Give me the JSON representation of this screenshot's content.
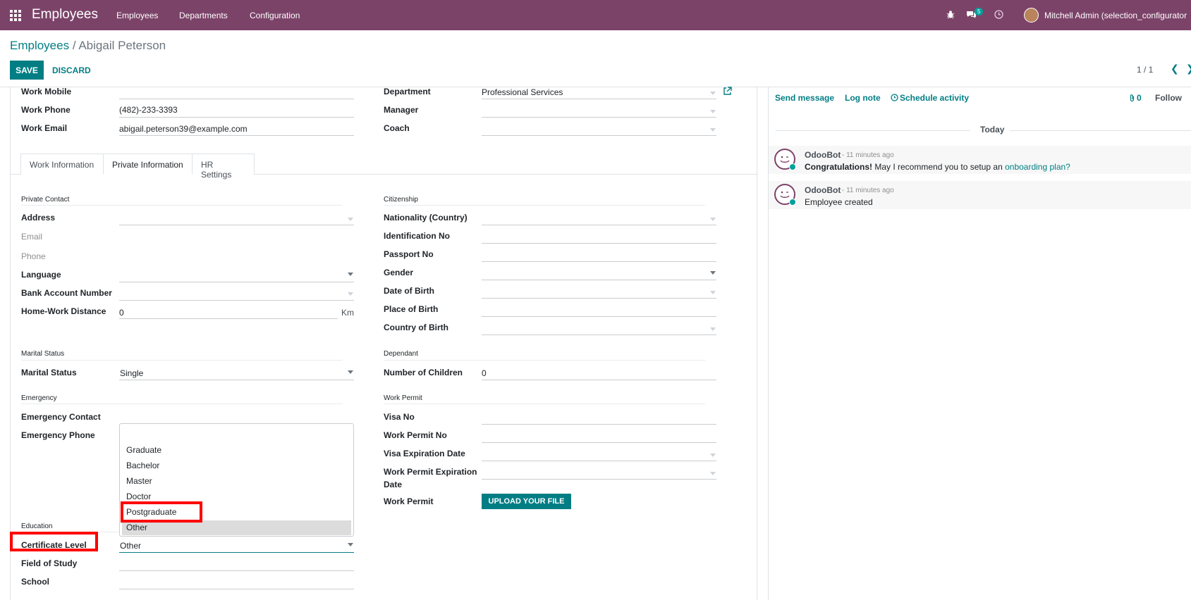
{
  "navbar": {
    "brand": "Employees",
    "menu": [
      "Employees",
      "Departments",
      "Configuration"
    ],
    "message_count": "5",
    "user": "Mitchell Admin (selection_configurator"
  },
  "breadcrumb": {
    "parent": "Employees",
    "separator": " / ",
    "current": "Abigail Peterson"
  },
  "buttons": {
    "save": "SAVE",
    "discard": "DISCARD",
    "upload": "UPLOAD YOUR FILE"
  },
  "pager": {
    "value": "1 / 1"
  },
  "header_fields": {
    "work_mobile": {
      "label": "Work Mobile",
      "value": ""
    },
    "work_phone": {
      "label": "Work Phone",
      "value": "(482)-233-3393"
    },
    "work_email": {
      "label": "Work Email",
      "value": "abigail.peterson39@example.com"
    },
    "department": {
      "label": "Department",
      "value": "Professional Services"
    },
    "manager": {
      "label": "Manager",
      "value": ""
    },
    "coach": {
      "label": "Coach",
      "value": ""
    }
  },
  "tabs": [
    "Work Information",
    "Private Information",
    "HR Settings"
  ],
  "private": {
    "private_contact": "Private Contact",
    "address": "Address",
    "email": "Email",
    "phone": "Phone",
    "language": "Language",
    "bank_account": "Bank Account Number",
    "home_work_distance": "Home-Work Distance",
    "distance_value": "0",
    "distance_unit": "Km",
    "marital_status_section": "Marital Status",
    "marital_status": "Marital Status",
    "marital_value": "Single",
    "emergency_section": "Emergency",
    "emergency_contact": "Emergency Contact",
    "emergency_phone": "Emergency Phone",
    "education_section": "Education",
    "certificate_level": "Certificate Level",
    "certificate_value": "Other",
    "field_of_study": "Field of Study",
    "school": "School"
  },
  "citizenship": {
    "section": "Citizenship",
    "nationality": "Nationality (Country)",
    "identification": "Identification No",
    "passport": "Passport No",
    "gender": "Gender",
    "dob": "Date of Birth",
    "pob": "Place of Birth",
    "cob": "Country of Birth",
    "dependant_section": "Dependant",
    "children": "Number of Children",
    "children_value": "0",
    "work_permit_section": "Work Permit",
    "visa_no": "Visa No",
    "work_permit_no": "Work Permit No",
    "visa_exp": "Visa Expiration Date",
    "wp_exp_1": "Work Permit Expiration",
    "wp_exp_2": "Date",
    "work_permit": "Work Permit"
  },
  "dropdown": {
    "options": [
      "Graduate",
      "Bachelor",
      "Master",
      "Doctor",
      "Postgraduate",
      "Other"
    ],
    "selected": "Other"
  },
  "chatter": {
    "send_message": "Send message",
    "log_note": "Log note",
    "schedule_activity": "Schedule activity",
    "attachments": "0",
    "follow": "Follow",
    "today": "Today",
    "messages": [
      {
        "author": "OdooBot",
        "ago": "- 11 minutes ago",
        "bold": "Congratulations!",
        "text": " May I recommend you to setup an ",
        "link": "onboarding plan?"
      },
      {
        "author": "OdooBot",
        "ago": "- 11 minutes ago",
        "text": "Employee created"
      }
    ]
  }
}
